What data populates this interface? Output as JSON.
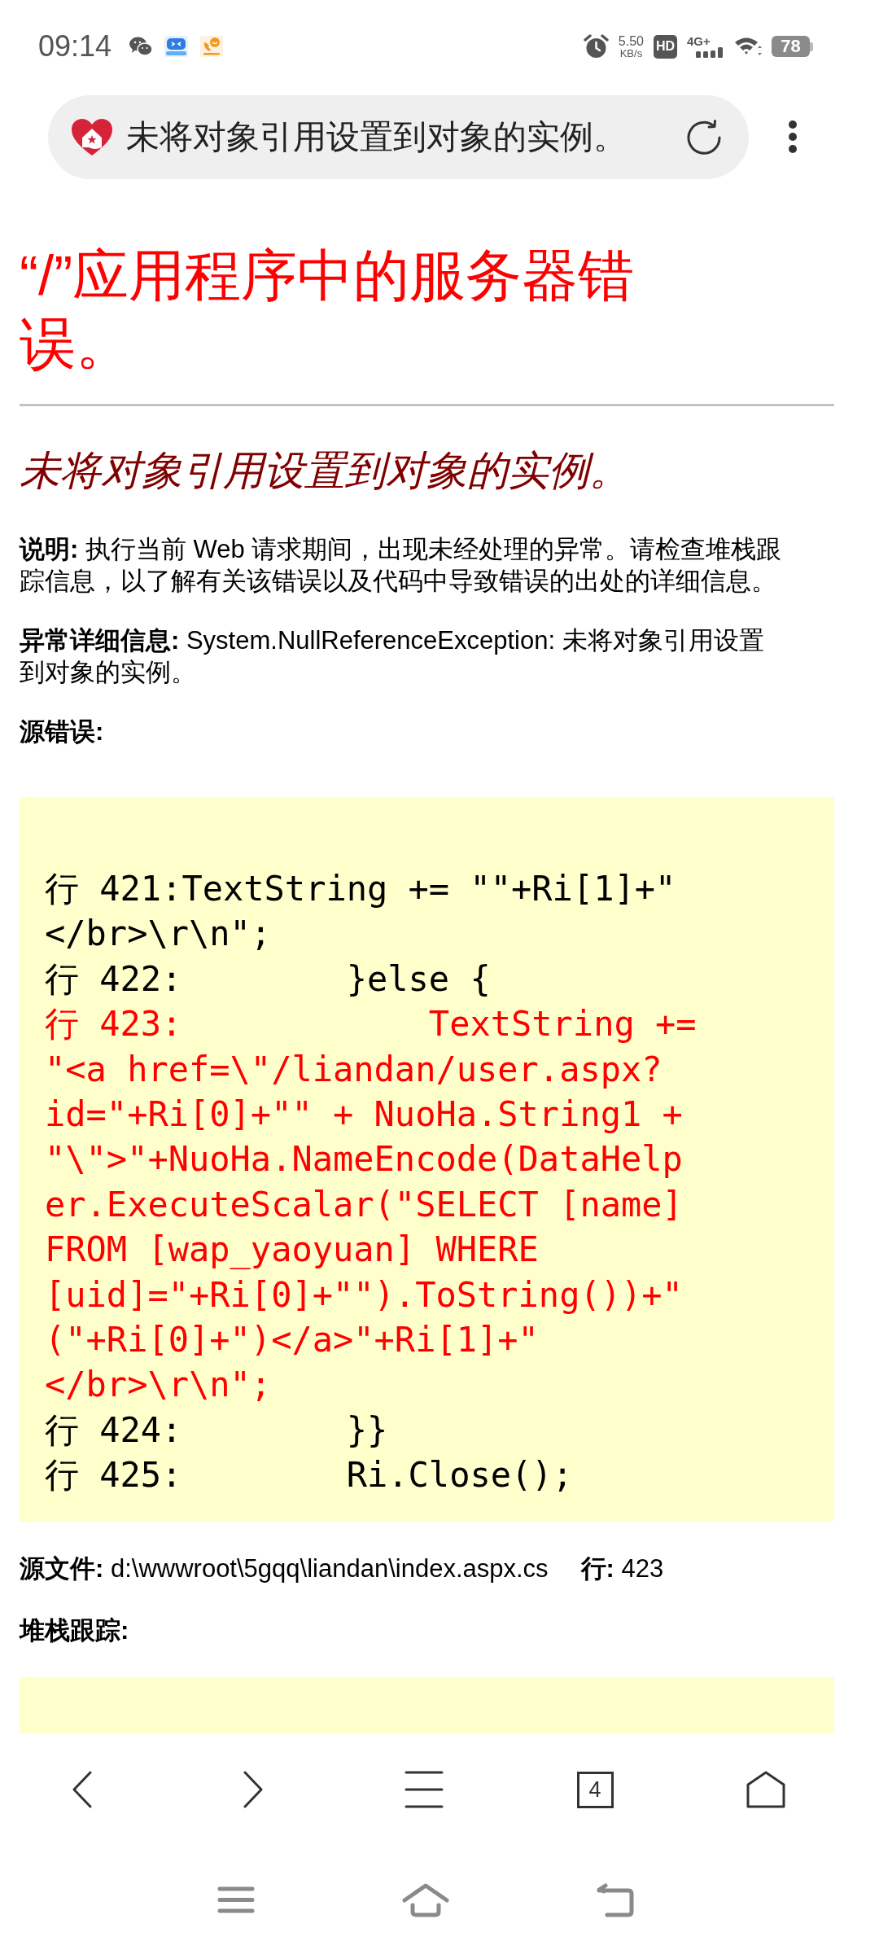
{
  "status_bar": {
    "time": "09:14",
    "net_speed": "5.50",
    "net_speed_unit": "KB/s",
    "hd_badge": "HD",
    "network_type": "4G+",
    "battery": "78"
  },
  "address_bar": {
    "title": "未将对象引用设置到对象的实例。"
  },
  "page": {
    "heading": "“/”应用程序中的服务器错误。",
    "message": "未将对象引用设置到对象的实例。",
    "description": "**说明:** 执行当前 Web 请求期间，出现未经处理的异常。请检查堆栈跟踪信息，以了解有关该错误以及代码中导致错误的出处的详细信息。",
    "exception_details": "**异常详细信息:** System.NullReferenceException: 未将对象引用设置到对象的实例。",
    "source_error_label": "源错误:",
    "source_code": [
      {
        "text": "行 421:TextString += \"\"+Ri[1]+\"</br>\\r\\n\";",
        "error": false
      },
      {
        "text": "行 422:        }else {",
        "error": false
      },
      {
        "text": "行 423:            TextString += \"<a href=\\\"/liandan/user.aspx?id=\"+Ri[0]+\"\" + NuoHa.String1 + \"\\\">\"+NuoHa.NameEncode(DataHelper.ExecuteScalar(\"SELECT [name] FROM [wap_yaoyuan] WHERE [uid]=\"+Ri[0]+\"\").ToString())+\"(\"+Ri[0]+\")</a>\"+Ri[1]+\"</br>\\r\\n\";",
        "error": true
      },
      {
        "text": "行 424:        }}",
        "error": false
      },
      {
        "text": "行 425:        Ri.Close();",
        "error": false
      }
    ],
    "source_file": "**源文件:** d:\\wwwroot\\5gqq\\liandan\\index.aspx.cs",
    "line": "**行:** 423",
    "stack_trace_label": "堆栈跟踪:"
  },
  "toolbar": {
    "tab_count": "4"
  }
}
